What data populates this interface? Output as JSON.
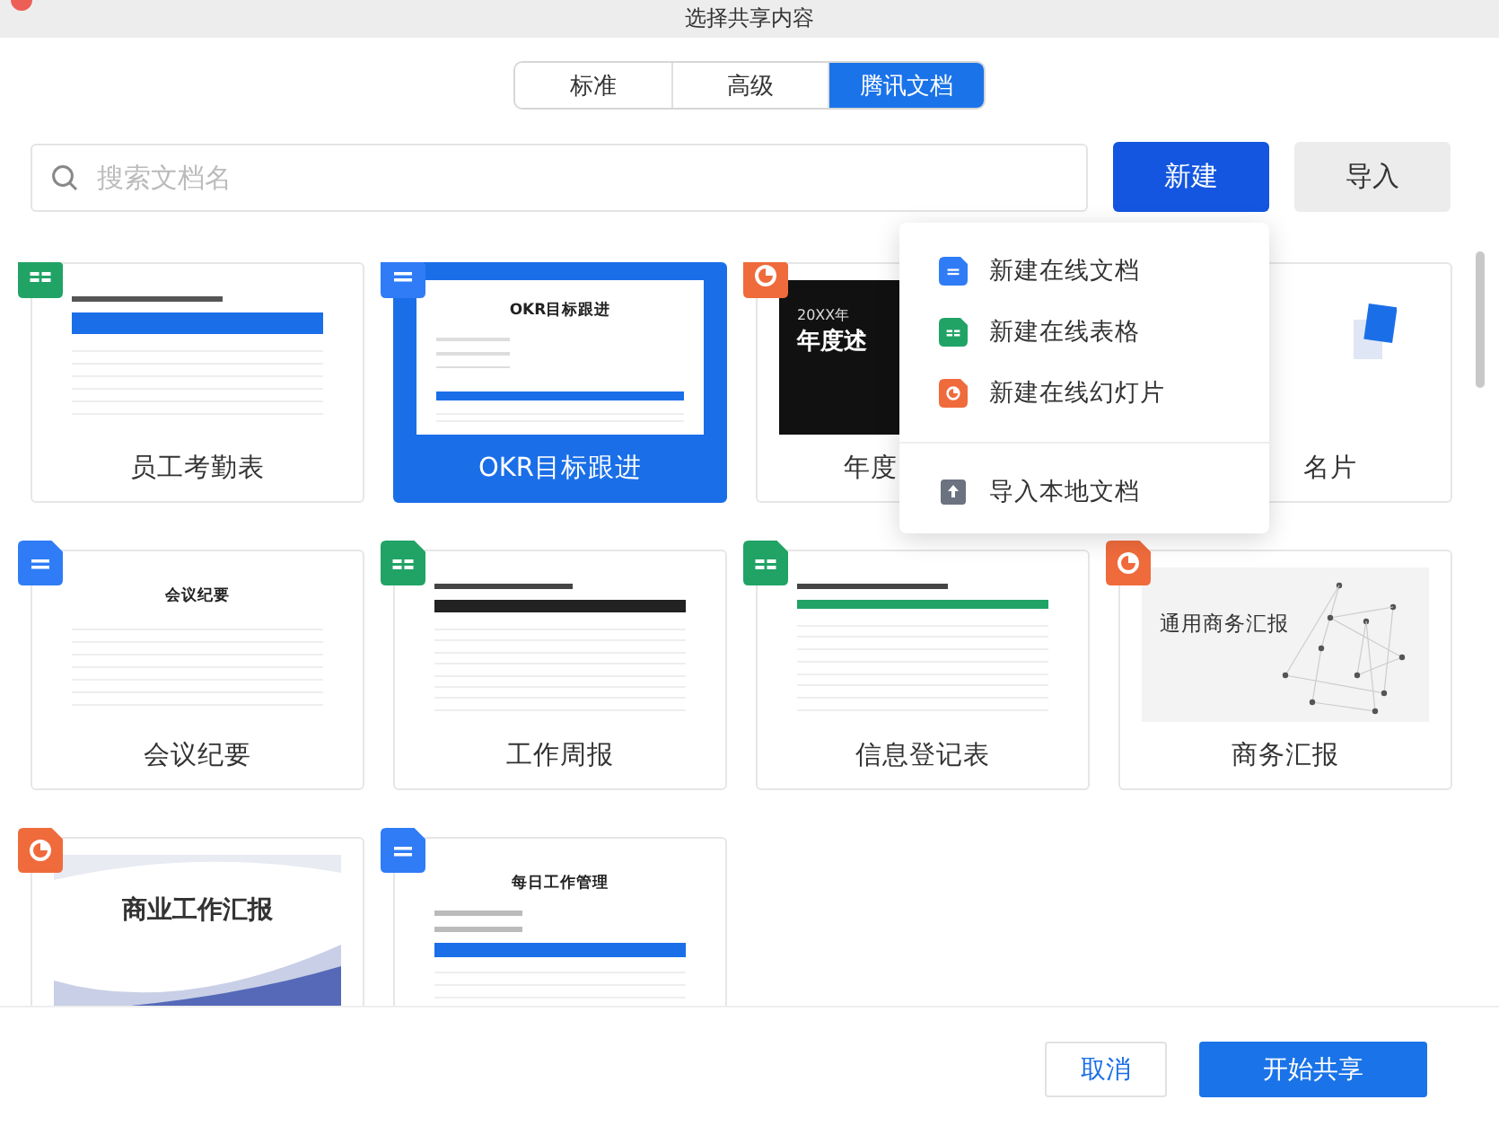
{
  "window": {
    "title": "选择共享内容"
  },
  "tabs": [
    {
      "label": "标准",
      "selected": false
    },
    {
      "label": "高级",
      "selected": false
    },
    {
      "label": "腾讯文档",
      "selected": true
    }
  ],
  "search": {
    "placeholder": "搜索文档名"
  },
  "buttons": {
    "new": "新建",
    "import": "导入"
  },
  "cards": [
    {
      "label": "员工考勤表",
      "kind": "sheet",
      "selected": false,
      "preview": {
        "kind": "table-blue"
      }
    },
    {
      "label": "OKR目标跟进",
      "kind": "doc",
      "selected": true,
      "preview": {
        "kind": "okr",
        "title": "OKR目标跟进"
      }
    },
    {
      "label": "年度",
      "kind": "slide",
      "selected": false,
      "covered_right": true,
      "preview": {
        "kind": "dark-slide",
        "title": "年度述",
        "subtitle": "20XX年"
      }
    },
    {
      "label": "名片",
      "selected": false,
      "covered_left": true,
      "preview": {
        "kind": "card"
      }
    },
    {
      "label": "会议纪要",
      "kind": "doc",
      "selected": false,
      "preview": {
        "kind": "form",
        "title": "会议纪要"
      }
    },
    {
      "label": "工作周报",
      "kind": "sheet",
      "selected": false,
      "preview": {
        "kind": "table-dark"
      }
    },
    {
      "label": "信息登记表",
      "kind": "sheet",
      "selected": false,
      "preview": {
        "kind": "table-green"
      }
    },
    {
      "label": "商务汇报",
      "kind": "slide",
      "selected": false,
      "preview": {
        "kind": "network",
        "title": "通用商务汇报"
      }
    },
    {
      "kind": "slide",
      "selected": false,
      "preview": {
        "kind": "wave",
        "title": "商业工作汇报"
      }
    },
    {
      "kind": "doc",
      "selected": false,
      "preview": {
        "kind": "daily",
        "title": "每日工作管理"
      }
    }
  ],
  "menu": [
    {
      "label": "新建在线文档",
      "kind": "doc"
    },
    {
      "label": "新建在线表格",
      "kind": "sheet"
    },
    {
      "label": "新建在线幻灯片",
      "kind": "slide"
    },
    {
      "label": "导入本地文档",
      "kind": "import"
    }
  ],
  "footer": {
    "cancel": "取消",
    "start": "开始共享"
  }
}
